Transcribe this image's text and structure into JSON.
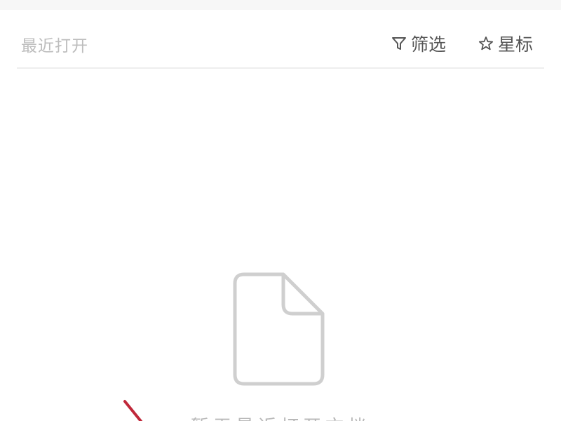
{
  "header": {
    "section_title": "最近打开",
    "filter_label": "筛选",
    "star_label": "星标"
  },
  "icons": {
    "filter": "filter-icon",
    "star": "star-outline-icon",
    "document": "document-icon"
  },
  "empty_state": {
    "message": "暂无最近打开文档"
  },
  "colors": {
    "accent_arrow": "#c0283a",
    "muted_text": "#bdbdbd",
    "icon_stroke": "#cfcfcf"
  }
}
